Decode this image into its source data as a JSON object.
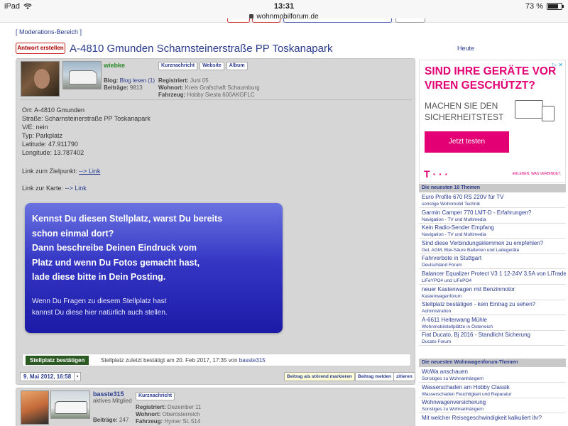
{
  "status_bar": {
    "device": "iPad",
    "time": "13:31",
    "battery": "73 %"
  },
  "address_bar": {
    "host": "wohnmobilforum.de"
  },
  "moderation_link": "[ Moderations-Bereich ]",
  "reply_button": "Antwort erstellen",
  "thread_title": "A-4810 Gmunden Scharnsteinerstraße PP Toskanapark",
  "today_link": "Heute",
  "post1": {
    "username": "wiebke",
    "buttons": [
      "Kurznachricht",
      "Website",
      "Album"
    ],
    "blog_label": "Blog:",
    "blog_value": "Blog lesen (1)",
    "posts_label": "Beiträge:",
    "posts_value": "9813",
    "registered_label": "Registriert:",
    "registered_value": "Juni 05",
    "location_label": "Wohnort:",
    "location_value": "Kreis Grafschaft Schaumburg",
    "vehicle_label": "Fahrzeug:",
    "vehicle_value": "Hobby Siesta 600AKGFLC",
    "body_lines": "Ort: A-4810 Gmunden\nStraße: Scharnsteinerstraße PP Toskanapark\nV/E: nein\nTyp: Parkplatz\nLatitude: 47.911790\nLongitude: 13.787402",
    "target_label": "Link zum Zielpunkt:",
    "target_link": "--> Link",
    "map_label": "Link zur Karte:",
    "map_link": "--> Link",
    "promo_main": "Kennst Du diesen Stellplatz, warst Du bereits schon einmal dort?\nDann beschreibe Deinen Eindruck vom Platz und wenn Du Fotos gemacht hast, lade diese bitte in Dein Posting.",
    "promo_main_lines": [
      "Kennst Du diesen Stellplatz, warst Du bereits",
      "schon einmal dort?",
      "Dann beschreibe Deinen Eindruck vom",
      "Platz und wenn Du Fotos gemacht hast,",
      "lade diese bitte in Dein Posting."
    ],
    "promo_sub_lines": [
      "Wenn Du Fragen zu diesem Stellplatz hast",
      "kannst Du diese hier natürlich auch stellen."
    ],
    "confirm_button": "Stellplatz bestätigen",
    "confirm_text": "Stellplatz zuletzt bestätigt am 20. Feb 2017, 17:35 von",
    "confirm_user": "basste315",
    "date": "9. Mai 2012, 16:58",
    "mini_button": "▪",
    "report_disturbing": "Beitrag als störend markieren",
    "report_post": "Beitrag melden",
    "quote": "zitieren"
  },
  "post2": {
    "username": "basste315",
    "role": "aktives Mitglied",
    "posts_label": "Beiträge:",
    "posts_value": "247",
    "button": "Kurznachricht",
    "registered_label": "Registriert:",
    "registered_value": "Dezember 11",
    "location_label": "Wohnort:",
    "location_value": "Oberösterreich",
    "vehicle_label": "Fahrzeug:",
    "vehicle_value": "Hymer SL 514"
  },
  "ad": {
    "adchoices": "▷ ✕",
    "headline_lines": [
      "SIND IHRE GERÄTE VOR",
      "VIREN GESCHÜTZT?"
    ],
    "sub_lines": [
      "MACHEN SIE DEN",
      "SICHERHEITSTEST"
    ],
    "cta": "Jetzt testen",
    "logo": "T · · ·",
    "tagline": "ERLEBEN, WAS VERBINDET.",
    "brand_color": "#e20074"
  },
  "sidebar": {
    "latest_topics_title": "Die neuesten 10 Themen",
    "latest_topics": [
      {
        "title": "Euro Profile 670 RS 220V für TV",
        "category": "sonstige Wohnmobil Technik"
      },
      {
        "title": "Garmin Camper 770 LMT-D - Erfahrungen?",
        "category": "Navigation - TV und Multimedia"
      },
      {
        "title": "Kein Radio-Sender Empfang",
        "category": "Navigation - TV und Multimedia"
      },
      {
        "title": "Sind diese Verbindungsklemmen zu empfehlen?",
        "category": "Gel, AGM, Blei-Säure Batterien und Ladegeräte"
      },
      {
        "title": "Fahrverbote in Stuttgart",
        "category": "Deutschland Forum"
      },
      {
        "title": "Balancer Equalizer Protect V3 1 12-24V 3,5A von LiTrade",
        "category": "LiFeYPO4 und LiFePO4"
      },
      {
        "title": "neuer Kastenwagen mit Benzinmotor",
        "category": "Kastenwagenforum"
      },
      {
        "title": "Stellplatz bestätigen - kein Eintrag zu sehen?",
        "category": "Administration"
      },
      {
        "title": "A-6611 Heiterwang Mühle",
        "category": "Wohnmobilstellplätze in Österreich"
      },
      {
        "title": "Fiat Ducato, Bj 2016 - Standlicht Sicherung",
        "category": "Ducato Forum"
      }
    ],
    "caravan_topics_title": "Die neuesten Wohnwagenforum-Themen",
    "caravan_topics": [
      {
        "title": "WoWa anschauen",
        "category": "Sonstiges zu Wohnanhängern"
      },
      {
        "title": "Wasserschaden am Hobby Classik",
        "category": "Wasserschaden Feuchtigkeit und Reparatur"
      },
      {
        "title": "Wohnwagenversicherung",
        "category": "Sonstiges zu Wohnanhängern"
      },
      {
        "title": "Mit welcher Reisegeschwindigkeit kalkuliert ihr?",
        "category": ""
      }
    ]
  }
}
